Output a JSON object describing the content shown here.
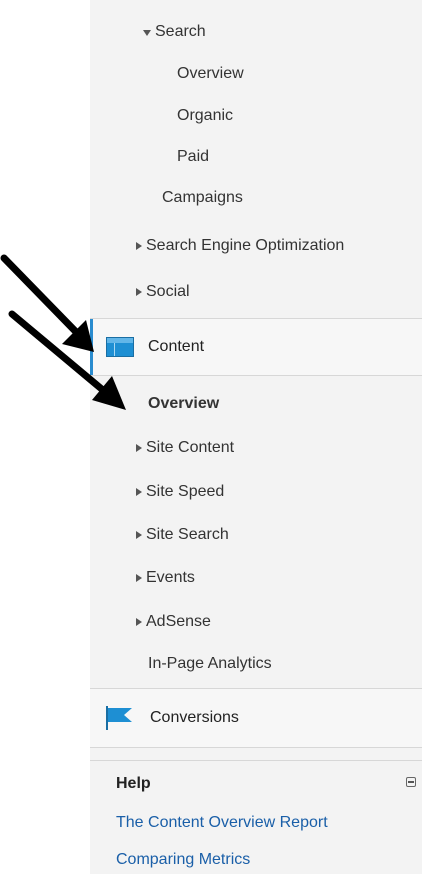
{
  "nav": {
    "search": "Search",
    "overview": "Overview",
    "organic": "Organic",
    "paid": "Paid",
    "campaigns": "Campaigns",
    "seo": "Search Engine Optimization",
    "social": "Social"
  },
  "content_section": {
    "label": "Content",
    "items": [
      {
        "label": "Overview",
        "active": true
      },
      {
        "label": "Site Content",
        "expandable": true
      },
      {
        "label": "Site Speed",
        "expandable": true
      },
      {
        "label": "Site Search",
        "expandable": true
      },
      {
        "label": "Events",
        "expandable": true
      },
      {
        "label": "AdSense",
        "expandable": true
      },
      {
        "label": "In-Page Analytics",
        "expandable": false
      }
    ]
  },
  "conversions": {
    "label": "Conversions"
  },
  "help": {
    "title": "Help",
    "links": [
      "The Content Overview Report",
      "Comparing Metrics"
    ]
  },
  "colors": {
    "accent": "#2a8ccf",
    "link": "#1a5fa8",
    "sidebar_bg": "#f3f3f3"
  },
  "icons": [
    "content-icon",
    "flag-icon",
    "collapse-icon",
    "arrow-annotation"
  ]
}
